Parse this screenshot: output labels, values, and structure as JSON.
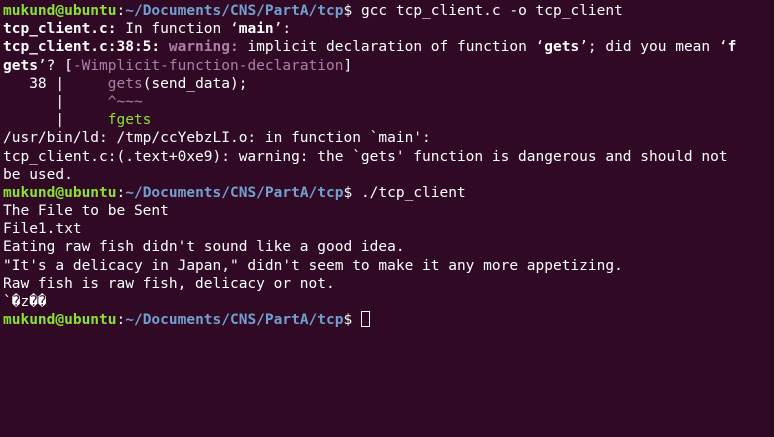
{
  "prompt": {
    "user_host": "mukund@ubuntu",
    "colon": ":",
    "path": "~/Documents/CNS/PartA/tcp",
    "dollar": "$ "
  },
  "commands": {
    "cmd1": "gcc tcp_client.c -o tcp_client",
    "cmd2": "./tcp_client",
    "cmd3": ""
  },
  "compiler": {
    "l1_file": "tcp_client.c:",
    "l1_text": " In function ",
    "l1_q_open": "‘",
    "l1_func": "main",
    "l1_q_close": "’:",
    "l2_loc": "tcp_client.c:38:5:",
    "l2_warning": " warning:",
    "l2_text": " implicit declaration of function ",
    "l2_q_open": "‘",
    "l2_func": "gets",
    "l2_q_close": "’",
    "l2_text2": "; did you mean ",
    "l2_q3_open": "‘",
    "l2_f": "f",
    "l3_rest": "gets",
    "l3_q_close": "’",
    "l3_q": "? [",
    "l3_flag": "-Wimplicit-function-declaration",
    "l3_bracket": "]",
    "l4_lineno": "   38 |     ",
    "l4_code_hl": "gets",
    "l4_code": "(send_data);",
    "l5_gutter": "      |     ",
    "l5_marker": "^~~~",
    "l6_gutter": "      |     ",
    "l6_fix": "fgets",
    "l7": "/usr/bin/ld: /tmp/ccYebzLI.o: in function `main':",
    "l8": "tcp_client.c:(.text+0xe9): warning: the `gets' function is dangerous and should not",
    "l9": "be used."
  },
  "program_output": [
    "The File to be Sent",
    "File1.txt",
    "Eating raw fish didn't sound like a good idea.",
    "\"It's a delicacy in Japan,\" didn't seem to make it any more appetizing.",
    "Raw fish is raw fish, delicacy or not.",
    "`�z��"
  ],
  "colors": {
    "background": "#300a24",
    "user_host": "#8ae234",
    "path": "#729fcf",
    "warning": "#ad7fa8",
    "fixit": "#8ae234",
    "text": "#ffffff"
  }
}
